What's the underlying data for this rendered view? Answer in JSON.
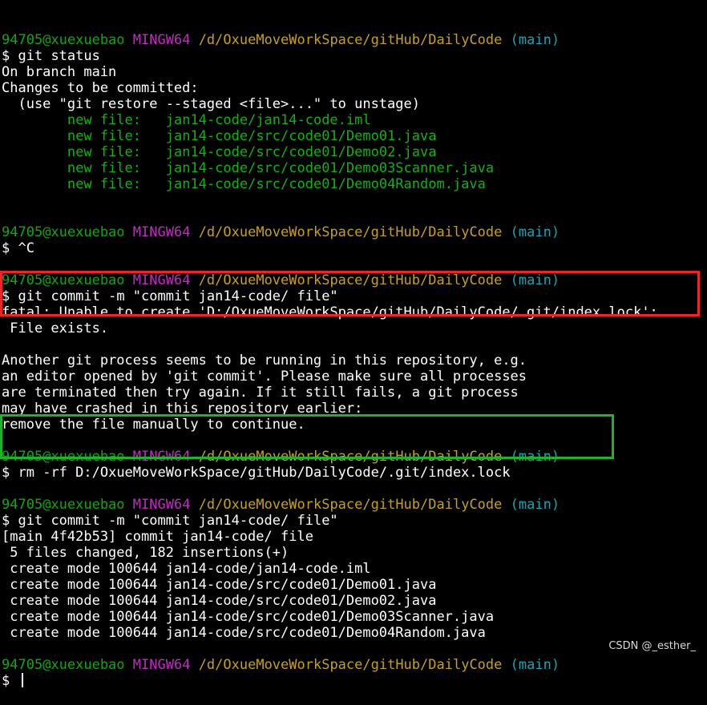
{
  "prompt": {
    "user": "94705@xuexuebao",
    "host": "MINGW64",
    "path": "/d/OxueMoveWorkSpace/gitHub/DailyCode",
    "branch": "(main)",
    "symbol": "$"
  },
  "lines": [
    {
      "kind": "prompt"
    },
    {
      "kind": "command",
      "text": "git status"
    },
    {
      "kind": "output",
      "text": "On branch main"
    },
    {
      "kind": "output",
      "text": "Changes to be committed:"
    },
    {
      "kind": "output",
      "text": "  (use \"git restore --staged <file>...\" to unstage)"
    },
    {
      "kind": "staged",
      "label": "new file:",
      "file": "jan14-code/jan14-code.iml"
    },
    {
      "kind": "staged",
      "label": "new file:",
      "file": "jan14-code/src/code01/Demo01.java"
    },
    {
      "kind": "staged",
      "label": "new file:",
      "file": "jan14-code/src/code01/Demo02.java"
    },
    {
      "kind": "staged",
      "label": "new file:",
      "file": "jan14-code/src/code01/Demo03Scanner.java"
    },
    {
      "kind": "staged",
      "label": "new file:",
      "file": "jan14-code/src/code01/Demo04Random.java"
    },
    {
      "kind": "blank"
    },
    {
      "kind": "blank"
    },
    {
      "kind": "prompt"
    },
    {
      "kind": "command",
      "text": "^C"
    },
    {
      "kind": "blank"
    },
    {
      "kind": "prompt"
    },
    {
      "kind": "command",
      "text": "git commit -m \"commit jan14-code/ file\""
    },
    {
      "kind": "output",
      "text": "fatal: Unable to create 'D:/OxueMoveWorkSpace/gitHub/DailyCode/.git/index.lock':"
    },
    {
      "kind": "output",
      "text": " File exists."
    },
    {
      "kind": "blank"
    },
    {
      "kind": "output",
      "text": "Another git process seems to be running in this repository, e.g."
    },
    {
      "kind": "output",
      "text": "an editor opened by 'git commit'. Please make sure all processes"
    },
    {
      "kind": "output",
      "text": "are terminated then try again. If it still fails, a git process"
    },
    {
      "kind": "output",
      "text": "may have crashed in this repository earlier:"
    },
    {
      "kind": "output",
      "text": "remove the file manually to continue."
    },
    {
      "kind": "blank"
    },
    {
      "kind": "prompt"
    },
    {
      "kind": "command",
      "text": "rm -rf D:/OxueMoveWorkSpace/gitHub/DailyCode/.git/index.lock"
    },
    {
      "kind": "blank"
    },
    {
      "kind": "prompt"
    },
    {
      "kind": "command",
      "text": "git commit -m \"commit jan14-code/ file\""
    },
    {
      "kind": "output",
      "text": "[main 4f42b53] commit jan14-code/ file"
    },
    {
      "kind": "output",
      "text": " 5 files changed, 182 insertions(+)"
    },
    {
      "kind": "output",
      "text": " create mode 100644 jan14-code/jan14-code.iml"
    },
    {
      "kind": "output",
      "text": " create mode 100644 jan14-code/src/code01/Demo01.java"
    },
    {
      "kind": "output",
      "text": " create mode 100644 jan14-code/src/code01/Demo02.java"
    },
    {
      "kind": "output",
      "text": " create mode 100644 jan14-code/src/code01/Demo03Scanner.java"
    },
    {
      "kind": "output",
      "text": " create mode 100644 jan14-code/src/code01/Demo04Random.java"
    },
    {
      "kind": "blank"
    },
    {
      "kind": "prompt"
    },
    {
      "kind": "command",
      "text": "",
      "cursor": true
    }
  ],
  "highlights": {
    "error_box_color": "#e8262c",
    "command_box_color": "#1fb32d"
  },
  "colors": {
    "background": "#000000",
    "user": "#0fa80f",
    "host": "#c12bc1",
    "path": "#c7a01a",
    "branch": "#13a6b3",
    "staged": "#13b013",
    "text": "#ffffff"
  },
  "watermark": "CSDN @_esther_"
}
